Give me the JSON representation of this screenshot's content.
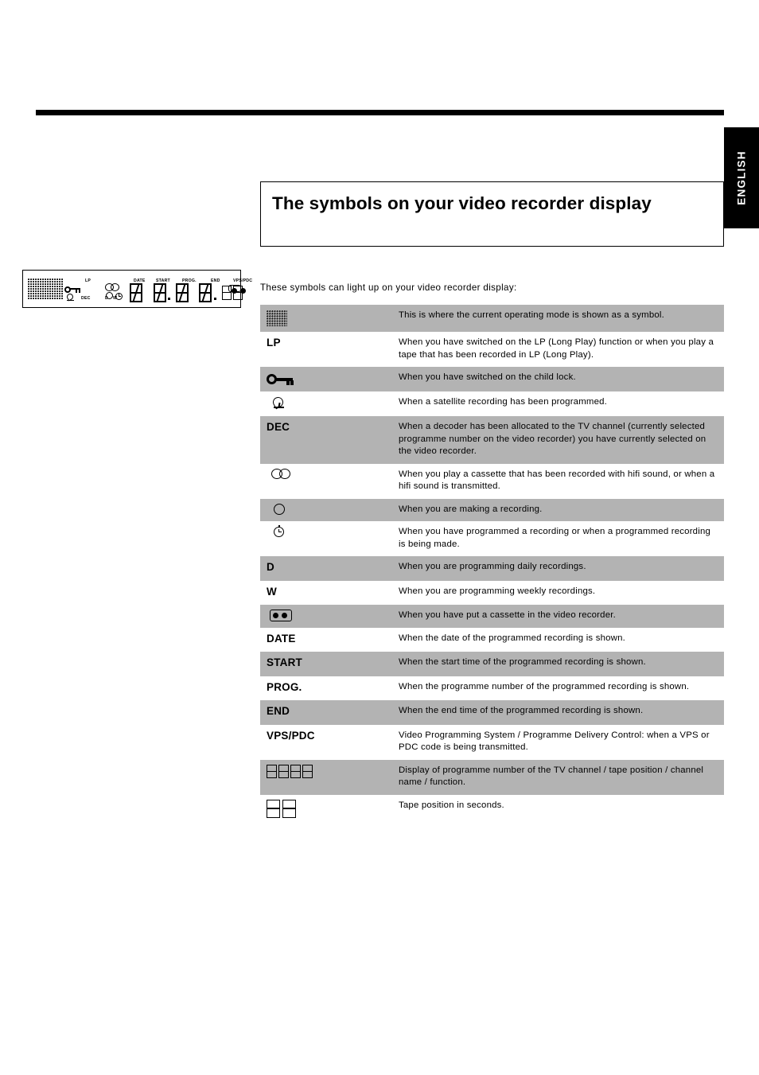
{
  "page": {
    "language_tab": "ENGLISH",
    "title": "The symbols on your video recorder display",
    "intro": "These symbols can light up on your video recorder display:"
  },
  "display_figure": {
    "labels": [
      "LP",
      "DATE",
      "START",
      "PROG.",
      "END",
      "VPS/PDC",
      "DEC",
      "D",
      "W"
    ],
    "icons": [
      "dot-matrix",
      "key",
      "satellite",
      "hifi",
      "record",
      "timer",
      "cassette",
      "seven-segment-digits"
    ]
  },
  "table": {
    "rows": [
      {
        "symbol_type": "icon",
        "icon": "dot-matrix-icon",
        "label": "",
        "description": "This is where the current operating mode is shown as a symbol.",
        "shaded": true
      },
      {
        "symbol_type": "text",
        "icon": "",
        "label": "LP",
        "description": "When you have switched on the LP (Long Play) function or when you play a tape that has been recorded in LP (Long Play).",
        "shaded": false
      },
      {
        "symbol_type": "icon",
        "icon": "key-icon",
        "label": "",
        "description": "When you have switched on the child lock.",
        "shaded": true
      },
      {
        "symbol_type": "icon",
        "icon": "satellite-dish-icon",
        "label": "",
        "description": "When a satellite recording has been programmed.",
        "shaded": false
      },
      {
        "symbol_type": "text",
        "icon": "",
        "label": "DEC",
        "description": "When a decoder has been allocated to the TV channel (currently selected programme number on the video recorder) you have currently selected on the video recorder.",
        "shaded": true
      },
      {
        "symbol_type": "icon",
        "icon": "hifi-icon",
        "label": "",
        "description": "When you play a cassette that has been recorded with hifi sound, or when a hifi sound is transmitted.",
        "shaded": false
      },
      {
        "symbol_type": "icon",
        "icon": "record-circle-icon",
        "label": "",
        "description": "When you are making a recording.",
        "shaded": true
      },
      {
        "symbol_type": "icon",
        "icon": "timer-clock-icon",
        "label": "",
        "description": "When you have programmed a recording or when a programmed recording is being made.",
        "shaded": false
      },
      {
        "symbol_type": "text",
        "icon": "",
        "label": "D",
        "description": "When you are programming daily recordings.",
        "shaded": true
      },
      {
        "symbol_type": "text",
        "icon": "",
        "label": "W",
        "description": "When you are programming weekly recordings.",
        "shaded": false
      },
      {
        "symbol_type": "icon",
        "icon": "cassette-icon",
        "label": "",
        "description": "When you have put a cassette in the video recorder.",
        "shaded": true
      },
      {
        "symbol_type": "text",
        "icon": "",
        "label": "DATE",
        "description": "When the date of the programmed recording is shown.",
        "shaded": false
      },
      {
        "symbol_type": "text",
        "icon": "",
        "label": "START",
        "description": "When the start time of the programmed recording is shown.",
        "shaded": true
      },
      {
        "symbol_type": "text",
        "icon": "",
        "label": "PROG.",
        "description": "When the programme number of the programmed recording is shown.",
        "shaded": false
      },
      {
        "symbol_type": "text",
        "icon": "",
        "label": "END",
        "description": "When the end time of the programmed recording is shown.",
        "shaded": true
      },
      {
        "symbol_type": "text",
        "icon": "",
        "label": "VPS/PDC",
        "description": "Video Programming System / Programme Delivery Control: when a VPS or PDC code is being transmitted.",
        "shaded": false
      },
      {
        "symbol_type": "icon",
        "icon": "four-digit-display-icon",
        "label": "",
        "description": "Display of programme number of the TV channel / tape position / channel name / function.",
        "shaded": true
      },
      {
        "symbol_type": "icon",
        "icon": "two-digit-display-icon",
        "label": "",
        "description": "Tape position in seconds.",
        "shaded": false
      }
    ]
  }
}
